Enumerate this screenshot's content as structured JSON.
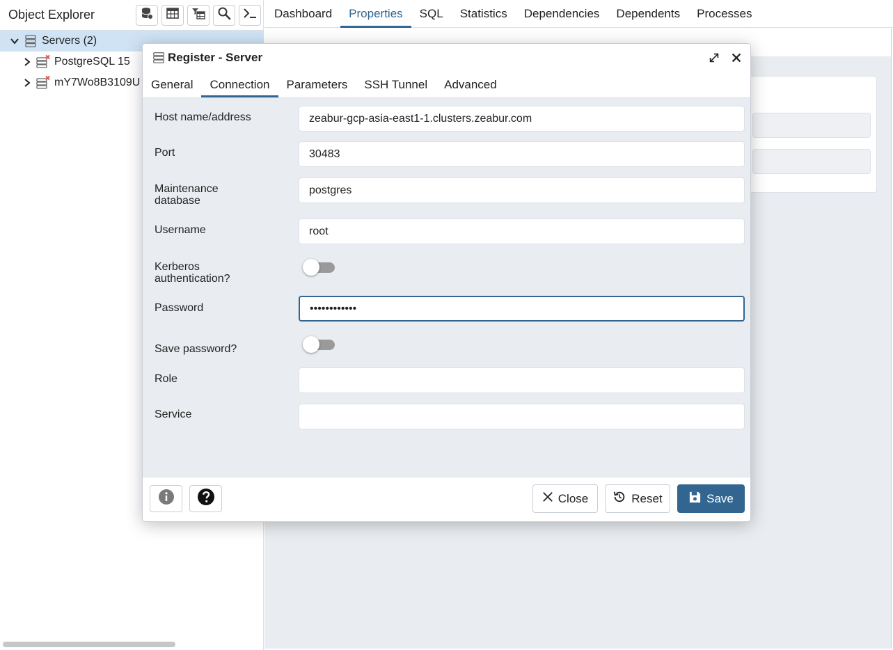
{
  "explorer": {
    "title": "Object Explorer",
    "tools": [
      "database-icon",
      "table-icon",
      "filtered-table-icon",
      "search-icon",
      "terminal-icon"
    ],
    "tree": {
      "root_label": "Servers (2)",
      "children": [
        {
          "label": "PostgreSQL 15"
        },
        {
          "label": "mY7Wo8B3109U"
        }
      ]
    }
  },
  "main_tabs": [
    {
      "label": "Dashboard"
    },
    {
      "label": "Properties"
    },
    {
      "label": "SQL"
    },
    {
      "label": "Statistics"
    },
    {
      "label": "Dependencies"
    },
    {
      "label": "Dependents"
    },
    {
      "label": "Processes"
    }
  ],
  "modal": {
    "title": "Register - Server",
    "tabs": [
      {
        "label": "General"
      },
      {
        "label": "Connection"
      },
      {
        "label": "Parameters"
      },
      {
        "label": "SSH Tunnel"
      },
      {
        "label": "Advanced"
      }
    ],
    "active_tab": "Connection",
    "fields": {
      "host": {
        "label": "Host name/address",
        "value": "zeabur-gcp-asia-east1-1.clusters.zeabur.com"
      },
      "port": {
        "label": "Port",
        "value": "30483"
      },
      "maintenance_db": {
        "label_line1": "Maintenance",
        "label_line2": "database",
        "value": "postgres"
      },
      "username": {
        "label": "Username",
        "value": "root"
      },
      "kerberos": {
        "label_line1": "Kerberos",
        "label_line2": "authentication?",
        "enabled": false
      },
      "password": {
        "label": "Password",
        "value": "••••••••••••"
      },
      "save_password": {
        "label": "Save password?",
        "enabled": false
      },
      "role": {
        "label": "Role",
        "value": ""
      },
      "service": {
        "label": "Service",
        "value": ""
      }
    },
    "footer": {
      "close_label": "Close",
      "reset_label": "Reset",
      "save_label": "Save"
    }
  },
  "colors": {
    "accent": "#326690",
    "selected_row": "#cfe3f5",
    "panel_bg": "#e9ecf0"
  }
}
